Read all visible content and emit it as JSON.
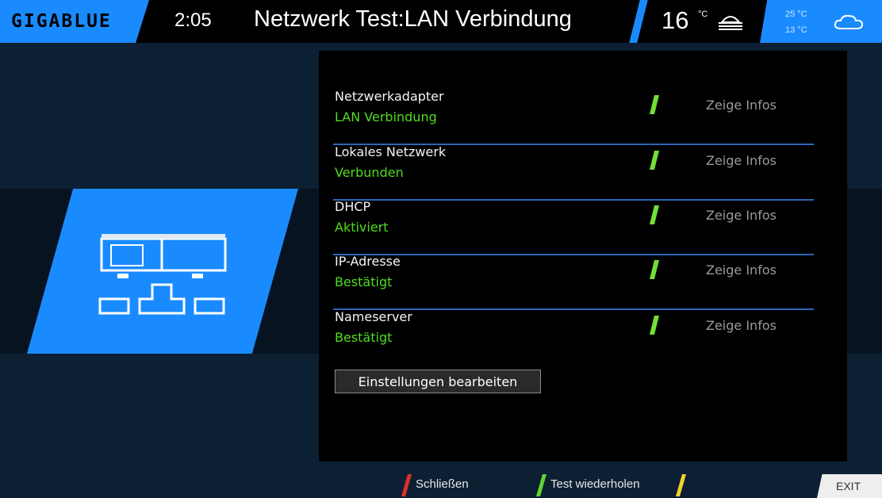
{
  "header": {
    "logo": "GIGABLUE",
    "clock": "2:05",
    "title": "Netzwerk Test:LAN Verbindung",
    "temp_now": "16",
    "temp_unit": "°C",
    "weather_now_icon": "fog-icon",
    "forecast_high": "25 °C",
    "forecast_low": "13 °C",
    "weather_forecast_icon": "cloud-icon"
  },
  "rows": [
    {
      "label": "Netzwerkadapter",
      "status": "LAN Verbindung",
      "info": "Zeige Infos"
    },
    {
      "label": "Lokales Netzwerk",
      "status": "Verbunden",
      "info": "Zeige Infos"
    },
    {
      "label": "DHCP",
      "status": "Aktiviert",
      "info": "Zeige Infos"
    },
    {
      "label": "IP-Adresse",
      "status": "Bestätigt",
      "info": "Zeige Infos"
    },
    {
      "label": "Nameserver",
      "status": "Bestätigt",
      "info": "Zeige Infos"
    }
  ],
  "edit_button": "Einstellungen bearbeiten",
  "footer": {
    "red": "Schließen",
    "green": "Test wiederholen",
    "yellow": "",
    "exit": "EXIT"
  },
  "colors": {
    "accent": "#1a8bff",
    "status_ok": "#4fdc1e",
    "check_mark": "#72e034",
    "key_red": "#e0312a",
    "key_green": "#5fd431",
    "key_yellow": "#f2d22c"
  }
}
